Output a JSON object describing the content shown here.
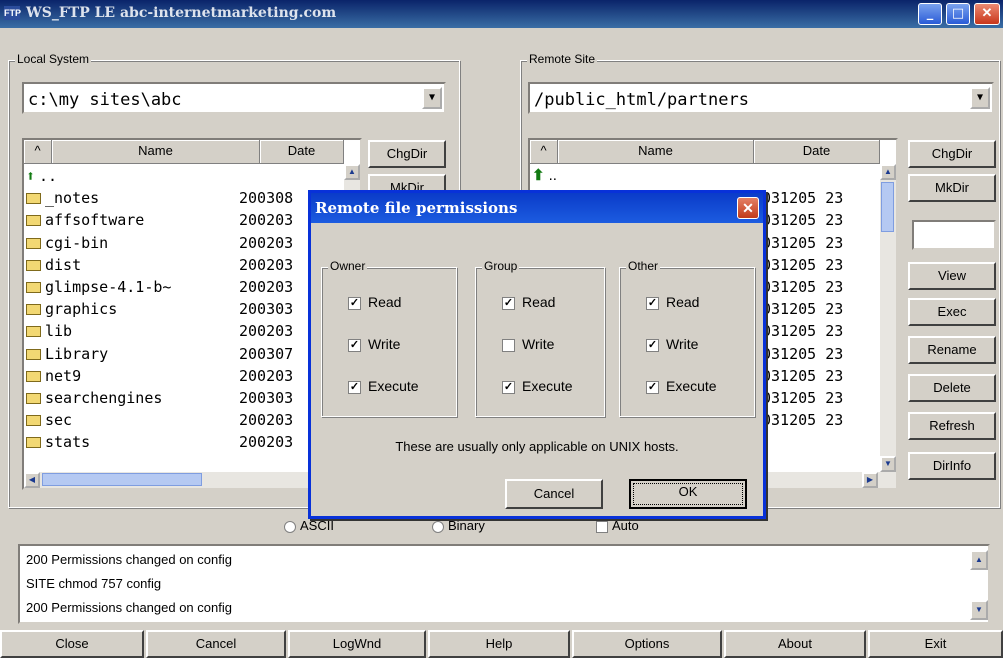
{
  "window": {
    "app_icon": "FTP",
    "title": "WS_FTP LE abc-internetmarketing.com",
    "controls": [
      "minimize-icon",
      "maximize-icon",
      "close-icon"
    ]
  },
  "local": {
    "legend": "Local System",
    "path": "c:\\my sites\\abc",
    "headers": {
      "sort": "^",
      "name": "Name",
      "date": "Date"
    },
    "files": [
      {
        "name": "..",
        "date": "",
        "type": "up"
      },
      {
        "name": "_notes",
        "date": "200308",
        "type": "folder"
      },
      {
        "name": "affsoftware",
        "date": "200203",
        "type": "folder"
      },
      {
        "name": "cgi-bin",
        "date": "200203",
        "type": "folder"
      },
      {
        "name": "dist",
        "date": "200203",
        "type": "folder"
      },
      {
        "name": "glimpse-4.1-b~",
        "date": "200203",
        "type": "folder"
      },
      {
        "name": "graphics",
        "date": "200303",
        "type": "folder"
      },
      {
        "name": "lib",
        "date": "200203",
        "type": "folder"
      },
      {
        "name": "Library",
        "date": "200307",
        "type": "folder"
      },
      {
        "name": "net9",
        "date": "200203",
        "type": "folder"
      },
      {
        "name": "searchengines",
        "date": "200303",
        "type": "folder"
      },
      {
        "name": "sec",
        "date": "200203",
        "type": "folder"
      },
      {
        "name": "stats",
        "date": "200203",
        "type": "folder"
      }
    ],
    "buttons": {
      "chgdir": "ChgDir",
      "mkdir": "MkDir"
    }
  },
  "remote": {
    "legend": "Remote Site",
    "path": "/public_html/partners",
    "headers": {
      "sort": "^",
      "name": "Name",
      "date": "Date"
    },
    "dates": [
      "",
      "031205 23",
      "031205 23",
      "031205 23",
      "031205 23",
      "031205 23",
      "031205 23",
      "031205 23",
      "031205 23",
      "031205 23",
      "031205 23",
      "031205 23"
    ],
    "buttons": [
      "ChgDir",
      "MkDir",
      "View",
      "Exec",
      "Rename",
      "Delete",
      "Refresh",
      "DirInfo"
    ]
  },
  "transfer_mode": {
    "ascii": "ASCII",
    "binary": "Binary",
    "auto": "Auto"
  },
  "log": [
    "200 Permissions changed on config",
    "SITE chmod 757 config",
    "200 Permissions changed on config"
  ],
  "bottom_buttons": [
    "Close",
    "Cancel",
    "LogWnd",
    "Help",
    "Options",
    "About",
    "Exit"
  ],
  "dialog": {
    "title": "Remote file permissions",
    "groups": [
      {
        "label": "Owner",
        "read": "Read",
        "write": "Write",
        "execute": "Execute",
        "checks": [
          true,
          true,
          true
        ]
      },
      {
        "label": "Group",
        "read": "Read",
        "write": "Write",
        "execute": "Execute",
        "checks": [
          true,
          false,
          true
        ]
      },
      {
        "label": "Other",
        "read": "Read",
        "write": "Write",
        "execute": "Execute",
        "checks": [
          true,
          true,
          true
        ]
      }
    ],
    "note": "These are usually only applicable on UNIX hosts.",
    "cancel": "Cancel",
    "ok": "OK"
  }
}
